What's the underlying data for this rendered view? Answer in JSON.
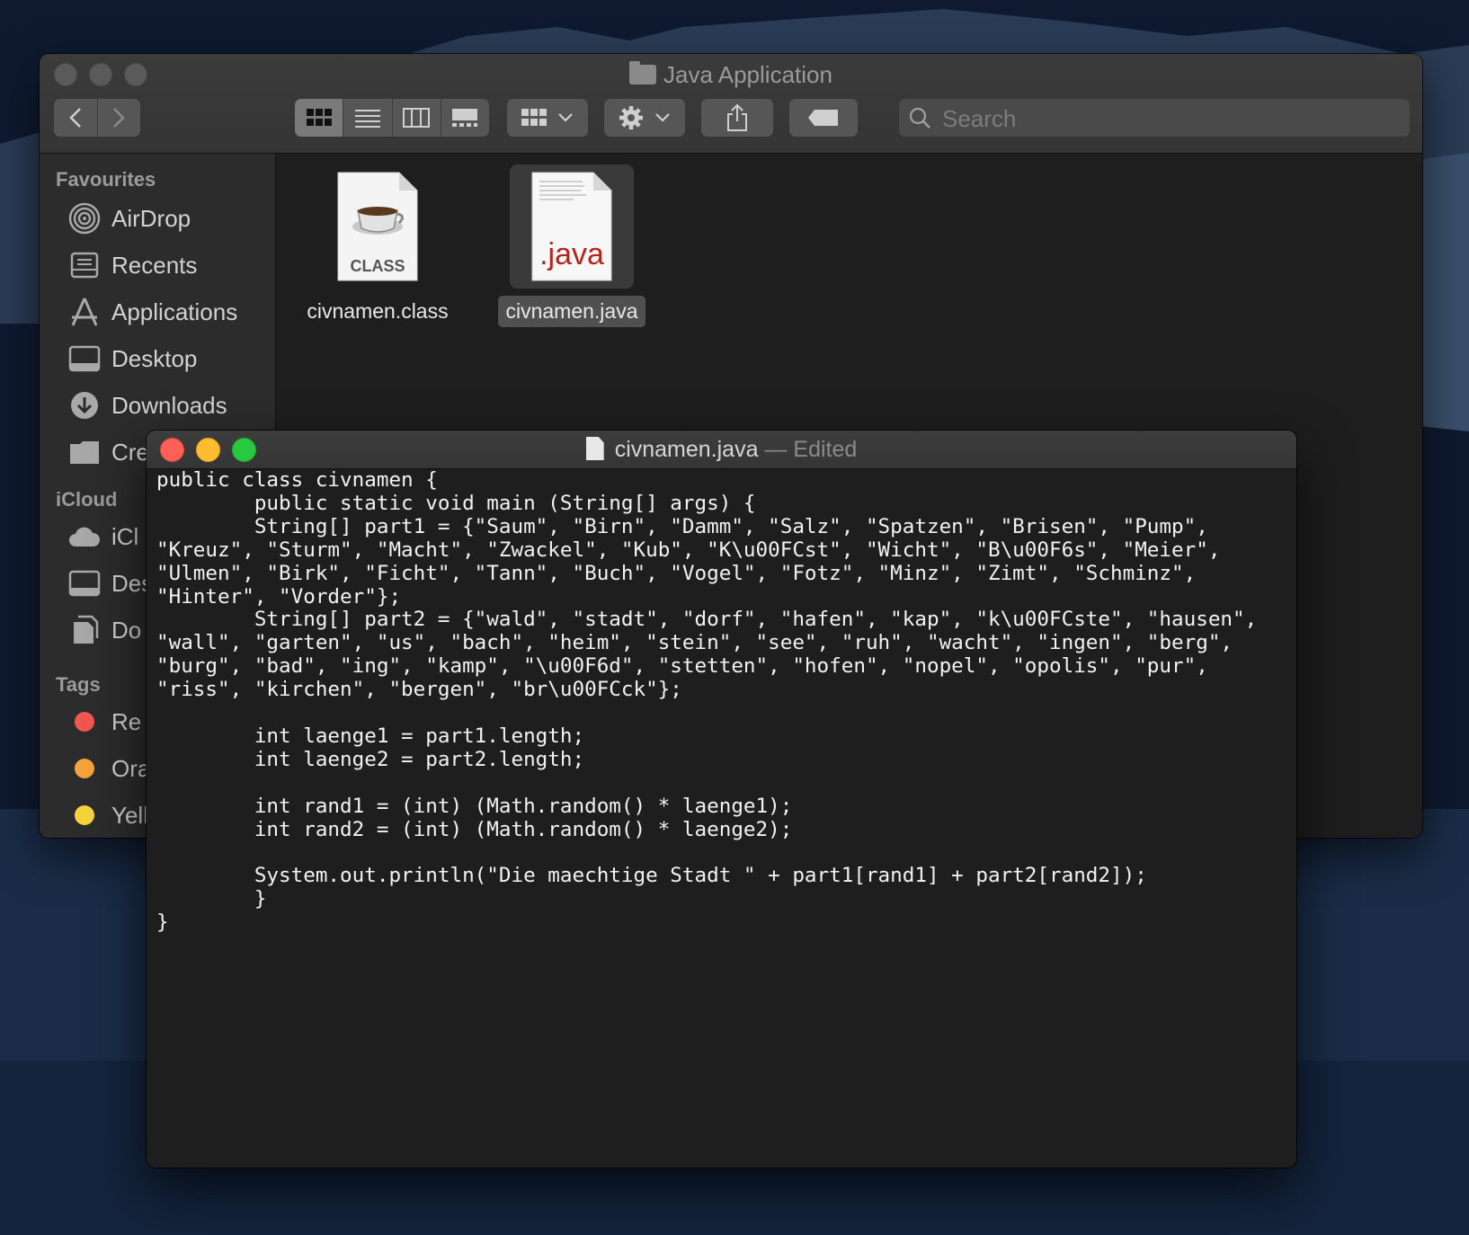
{
  "finder": {
    "title": "Java Application",
    "search_placeholder": "Search",
    "sidebar": {
      "favourites_heading": "Favourites",
      "favourites": [
        {
          "label": "AirDrop",
          "icon": "airdrop-icon"
        },
        {
          "label": "Recents",
          "icon": "recents-icon"
        },
        {
          "label": "Applications",
          "icon": "applications-icon"
        },
        {
          "label": "Desktop",
          "icon": "desktop-icon"
        },
        {
          "label": "Downloads",
          "icon": "downloads-icon"
        },
        {
          "label": "Cre",
          "icon": "folder-icon"
        }
      ],
      "icloud_heading": "iCloud",
      "icloud": [
        {
          "label": "iCl",
          "icon": "icloud-icon"
        },
        {
          "label": "Des",
          "icon": "desktop-icon"
        },
        {
          "label": "Do",
          "icon": "documents-icon"
        }
      ],
      "tags_heading": "Tags",
      "tags": [
        {
          "label": "Re",
          "color": "#f0564f"
        },
        {
          "label": "Ora",
          "color": "#f5a33a"
        },
        {
          "label": "Yell",
          "color": "#f5d33b"
        }
      ]
    },
    "files": [
      {
        "name": "civnamen.class",
        "badge": "CLASS",
        "selected": false
      },
      {
        "name": "civnamen.java",
        "badge": ".java",
        "selected": true
      }
    ]
  },
  "textedit": {
    "filename": "civnamen.java",
    "status": "— Edited",
    "lines": [
      "public class civnamen {",
      "        public static void main (String[] args) {",
      "        String[] part1 = {\"Saum\", \"Birn\", \"Damm\", \"Salz\", \"Spatzen\", \"Brisen\", \"Pump\",",
      "\"Kreuz\", \"Sturm\", \"Macht\", \"Zwackel\", \"Kub\", \"K\\u00FCst\", \"Wicht\", \"B\\u00F6s\", \"Meier\",",
      "\"Ulmen\", \"Birk\", \"Ficht\", \"Tann\", \"Buch\", \"Vogel\", \"Fotz\", \"Minz\", \"Zimt\", \"Schminz\",",
      "\"Hinter\", \"Vorder\"};",
      "        String[] part2 = {\"wald\", \"stadt\", \"dorf\", \"hafen\", \"kap\", \"k\\u00FCste\", \"hausen\",",
      "\"wall\", \"garten\", \"us\", \"bach\", \"heim\", \"stein\", \"see\", \"ruh\", \"wacht\", \"ingen\", \"berg\",",
      "\"burg\", \"bad\", \"ing\", \"kamp\", \"\\u00F6d\", \"stetten\", \"hofen\", \"nopel\", \"opolis\", \"pur\",",
      "\"riss\", \"kirchen\", \"bergen\", \"br\\u00FCck\"};",
      "",
      "        int laenge1 = part1.length;",
      "        int laenge2 = part2.length;",
      "",
      "        int rand1 = (int) (Math.random() * laenge1);",
      "        int rand2 = (int) (Math.random() * laenge2);",
      "",
      "        System.out.println(\"Die maechtige Stadt \" + part1[rand1] + part2[rand2]);",
      "        }",
      "}"
    ]
  }
}
